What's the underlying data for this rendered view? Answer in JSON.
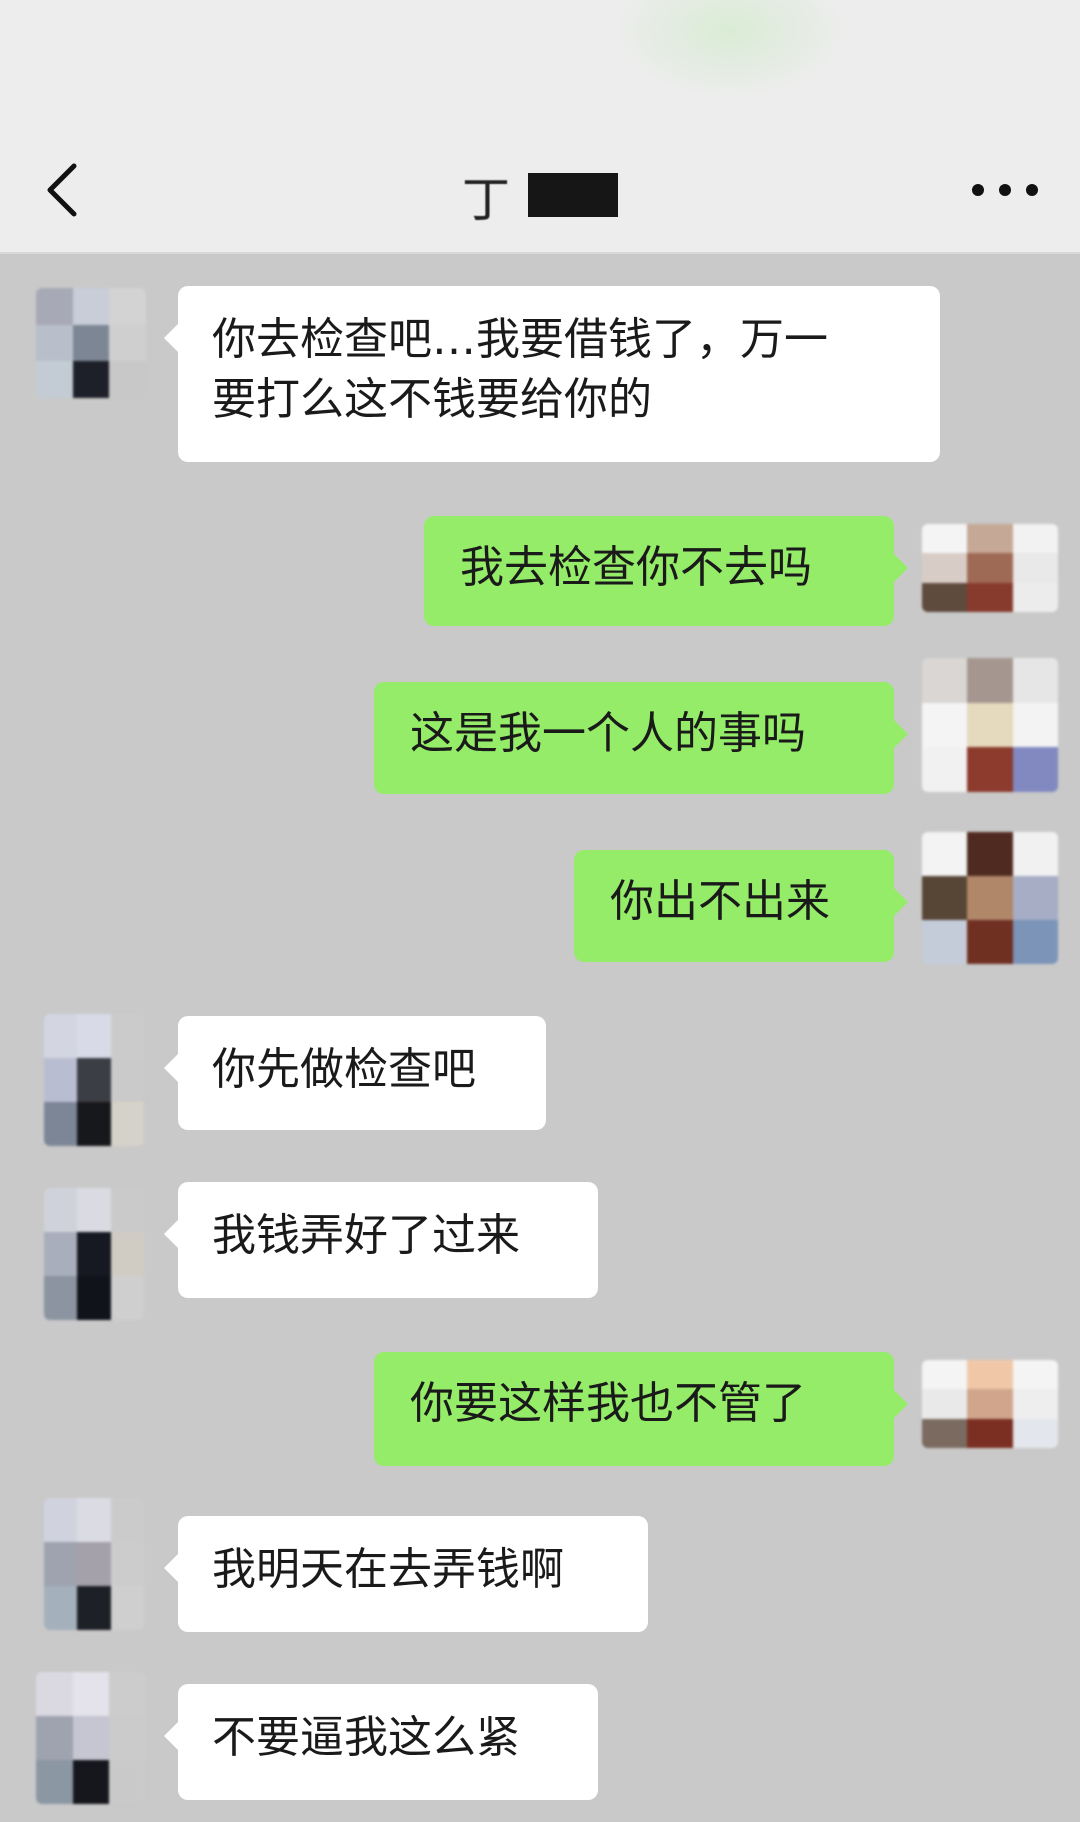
{
  "header": {
    "title": "丁",
    "back_icon": "chevron-left-icon",
    "more_icon": "more-dots-icon"
  },
  "messages": [
    {
      "side": "left",
      "text": "你去检查吧…我要借钱了，万一要打么这不钱要给你的",
      "line1": "你去检查吧…我要借钱了，万一",
      "line2": "要打么这不钱要给你的"
    },
    {
      "side": "right",
      "text": "我去检查你不去吗"
    },
    {
      "side": "right",
      "text": "这是我一个人的事吗"
    },
    {
      "side": "right",
      "text": "你出不出来"
    },
    {
      "side": "left",
      "text": "你先做检查吧"
    },
    {
      "side": "left",
      "text": "我钱弄好了过来"
    },
    {
      "side": "right",
      "text": "你要这样我也不管了"
    },
    {
      "side": "left",
      "text": "我明天在去弄钱啊"
    },
    {
      "side": "left",
      "text": "不要逼我这么紧"
    }
  ],
  "colors": {
    "chat_background": "#c9c9c9",
    "header_background": "#ededed",
    "sent_bubble": "#95ec69",
    "received_bubble": "#ffffff"
  }
}
